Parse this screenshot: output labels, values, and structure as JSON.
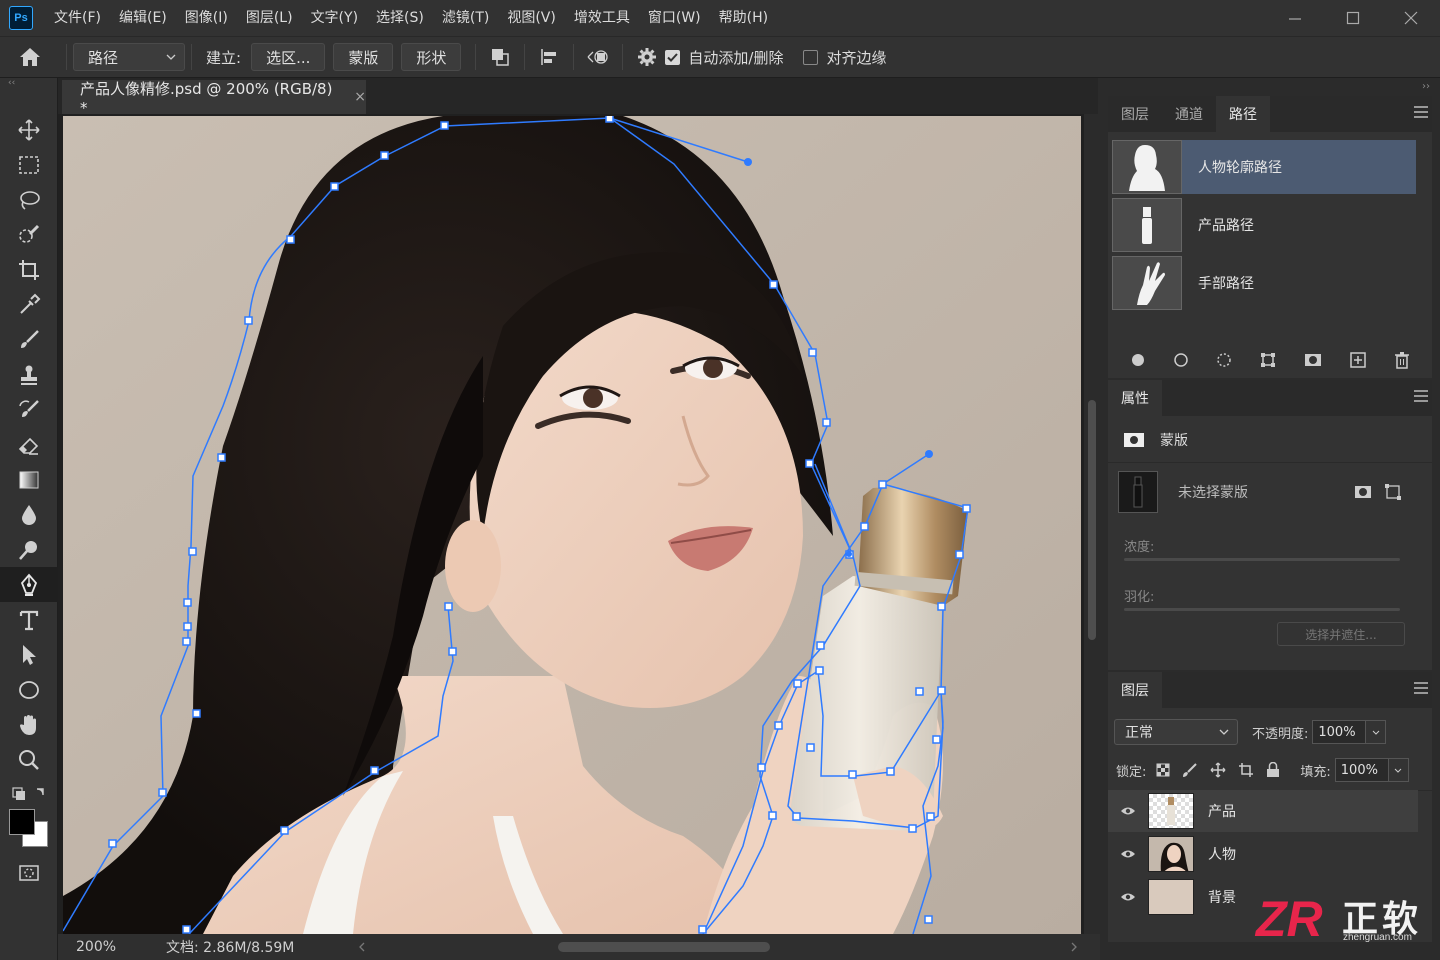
{
  "app": {
    "logo_text": "Ps"
  },
  "menu": [
    "文件(F)",
    "编辑(E)",
    "图像(I)",
    "图层(L)",
    "文字(Y)",
    "选择(S)",
    "滤镜(T)",
    "视图(V)",
    "增效工具",
    "窗口(W)",
    "帮助(H)"
  ],
  "options": {
    "mode": "路径",
    "make_label": "建立:",
    "selection_btn": "选区...",
    "mask_btn": "蒙版",
    "shape_btn": "形状",
    "auto_add_delete": "自动添加/删除",
    "auto_add_delete_checked": true,
    "align_edges": "对齐边缘",
    "align_edges_checked": false
  },
  "document": {
    "tab_title": "产品人像精修.psd @ 200% (RGB/8) *",
    "close": "×"
  },
  "status": {
    "zoom": "200%",
    "doc_size": "文档: 2.86M/8.59M"
  },
  "paths_panel": {
    "tabs": [
      "图层",
      "通道",
      "路径"
    ],
    "active_tab": 2,
    "paths": [
      {
        "name": "人物轮廓路径",
        "selected": true
      },
      {
        "name": "产品路径",
        "selected": false
      },
      {
        "name": "手部路径",
        "selected": false
      }
    ]
  },
  "properties_panel": {
    "title": "属性",
    "mask_label": "蒙版",
    "no_mask": "未选择蒙版",
    "density": "浓度:",
    "feather": "羽化:",
    "select_and_mask": "选择并遮住..."
  },
  "layers_panel": {
    "title": "图层",
    "blend_mode": "正常",
    "opacity_label": "不透明度:",
    "opacity": "100%",
    "lock_label": "锁定:",
    "fill_label": "填充:",
    "fill": "100%",
    "layers": [
      {
        "name": "产品",
        "visible": true,
        "selected": true
      },
      {
        "name": "人物",
        "visible": true,
        "selected": false
      },
      {
        "name": "背景",
        "visible": true,
        "selected": false
      }
    ]
  },
  "watermark": {
    "logo": "ZR",
    "text": "正软",
    "url": "zhengruan.com"
  },
  "colors": {
    "accent": "#31a8ff",
    "path": "#2f7bff",
    "selection": "#4c5b72"
  }
}
